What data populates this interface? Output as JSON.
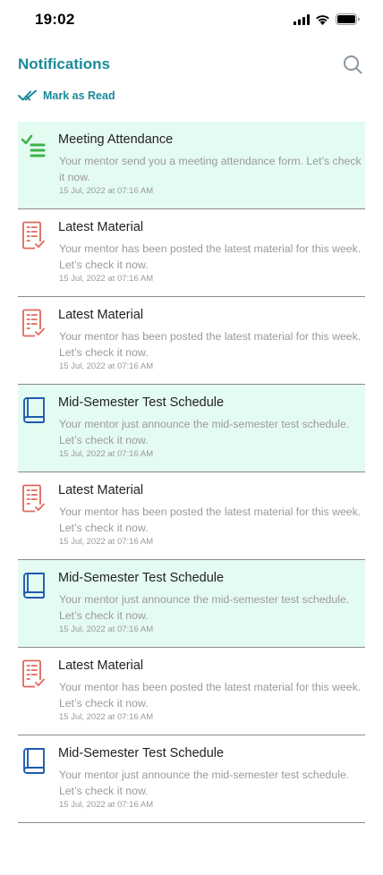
{
  "status_bar": {
    "time": "19:02",
    "icons": [
      "signal-icon",
      "wifi-icon",
      "battery-icon"
    ]
  },
  "header": {
    "title": "Notifications",
    "search_icon": "search-icon"
  },
  "mark_as_read": {
    "label": "Mark as Read",
    "icon": "double-check-icon"
  },
  "colors": {
    "accent": "#1a8a9a",
    "unread_bg": "#e4fbf2",
    "attendance_icon": "#3cb44b",
    "material_icon": "#e0675c",
    "schedule_icon": "#1e5bb0"
  },
  "notifications": [
    {
      "icon": "checklist-icon",
      "unread": true,
      "title": "Meeting Attendance",
      "body": "Your mentor send you a meeting attendance form. Let’s check it now.",
      "time": "15 Jul, 2022 at 07:16 AM"
    },
    {
      "icon": "document-check-icon",
      "unread": false,
      "title": "Latest Material",
      "body": "Your mentor has been posted the latest material for this week. Let’s check it now.",
      "time": "15 Jul, 2022 at 07:16 AM"
    },
    {
      "icon": "document-check-icon",
      "unread": false,
      "title": "Latest Material",
      "body": "Your mentor has been posted the latest material for this week. Let’s check it now.",
      "time": "15 Jul, 2022 at 07:16 AM"
    },
    {
      "icon": "book-icon",
      "unread": true,
      "title": "Mid-Semester Test Schedule",
      "body": "Your mentor just announce the mid-semester test schedule. Let’s check it now.",
      "time": "15 Jul, 2022 at 07:16 AM"
    },
    {
      "icon": "document-check-icon",
      "unread": false,
      "title": "Latest Material",
      "body": "Your mentor has been posted the latest material for this week. Let’s check it now.",
      "time": "15 Jul, 2022 at 07:16 AM"
    },
    {
      "icon": "book-icon",
      "unread": true,
      "title": "Mid-Semester Test Schedule",
      "body": "Your mentor just announce the mid-semester test schedule. Let’s check it now.",
      "time": "15 Jul, 2022 at 07:16 AM"
    },
    {
      "icon": "document-check-icon",
      "unread": false,
      "title": "Latest Material",
      "body": "Your mentor has been posted the latest material for this week. Let’s check it now.",
      "time": "15 Jul, 2022 at 07:16 AM"
    },
    {
      "icon": "book-icon",
      "unread": false,
      "title": "Mid-Semester Test Schedule",
      "body": "Your mentor just announce the mid-semester test schedule. Let’s check it now.",
      "time": "15 Jul, 2022 at 07:16 AM"
    }
  ]
}
